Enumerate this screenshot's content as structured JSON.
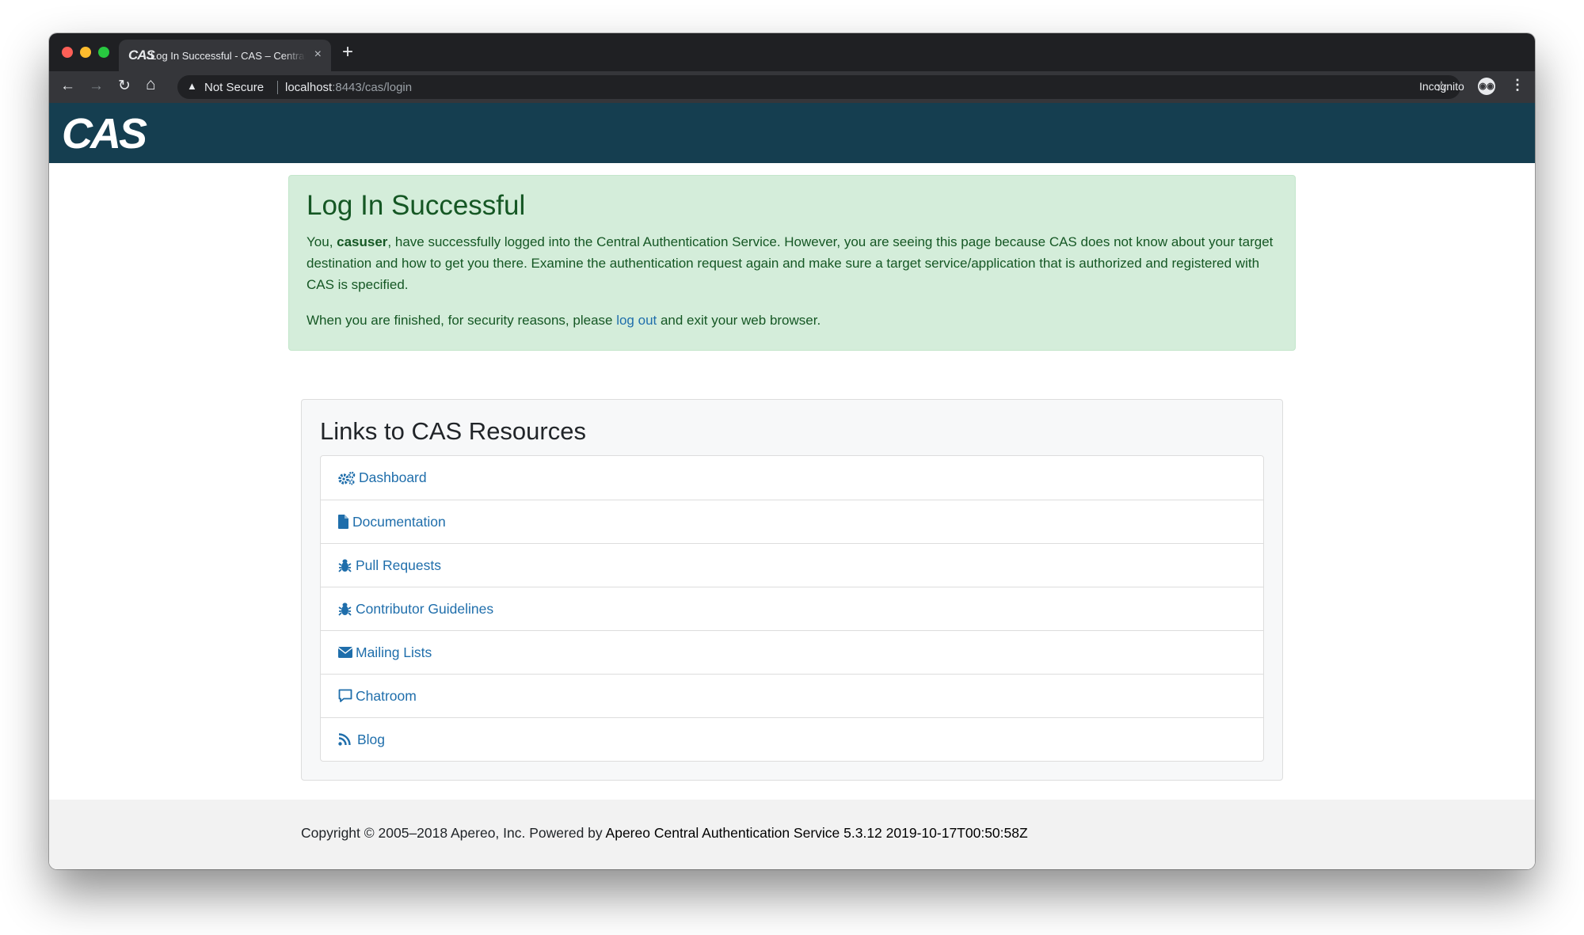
{
  "browser": {
    "tab": {
      "favicon_text": "CAS",
      "title": "Log In Successful - CAS – Central Authentication Service",
      "close_glyph": "×"
    },
    "new_tab_glyph": "+",
    "toolbar": {
      "back_glyph": "←",
      "forward_glyph": "→",
      "reload_glyph": "↻",
      "home_glyph": "⌂",
      "security_label": "Not Secure",
      "url_host": "localhost",
      "url_rest": ":8443/cas/login",
      "star_glyph": "☆",
      "profile_label": "Incognito",
      "menu_glyph": "⋮"
    }
  },
  "header": {
    "logo_text": "CAS"
  },
  "alert": {
    "title": "Log In Successful",
    "p1_before": "You, ",
    "username": "casuser",
    "p1_after": ", have successfully logged into the Central Authentication Service. However, you are seeing this page because CAS does not know about your target destination and how to get you there. Examine the authentication request again and make sure a target service/application that is authorized and registered with CAS is specified.",
    "p2_before": "When you are finished, for security reasons, please ",
    "logout_link": "log out",
    "p2_after": " and exit your web browser."
  },
  "resources": {
    "title": "Links to CAS Resources",
    "links": [
      {
        "label": "Dashboard",
        "icon": "gears-icon"
      },
      {
        "label": "Documentation",
        "icon": "file-icon"
      },
      {
        "label": "Pull Requests",
        "icon": "bug-icon"
      },
      {
        "label": "Contributor Guidelines",
        "icon": "bug-icon"
      },
      {
        "label": "Mailing Lists",
        "icon": "envelope-icon"
      },
      {
        "label": "Chatroom",
        "icon": "comment-icon"
      },
      {
        "label": "Blog",
        "icon": "rss-icon"
      }
    ]
  },
  "footer": {
    "copyright": "Copyright © 2005–2018 Apereo, Inc. Powered by ",
    "app_name": "Apereo Central Authentication Service 5.3.12 2019-10-17T00:50:58Z"
  },
  "colors": {
    "header_bg": "#153e50",
    "alert_bg": "#d4edda",
    "alert_text": "#155724",
    "link": "#1f6eab"
  }
}
